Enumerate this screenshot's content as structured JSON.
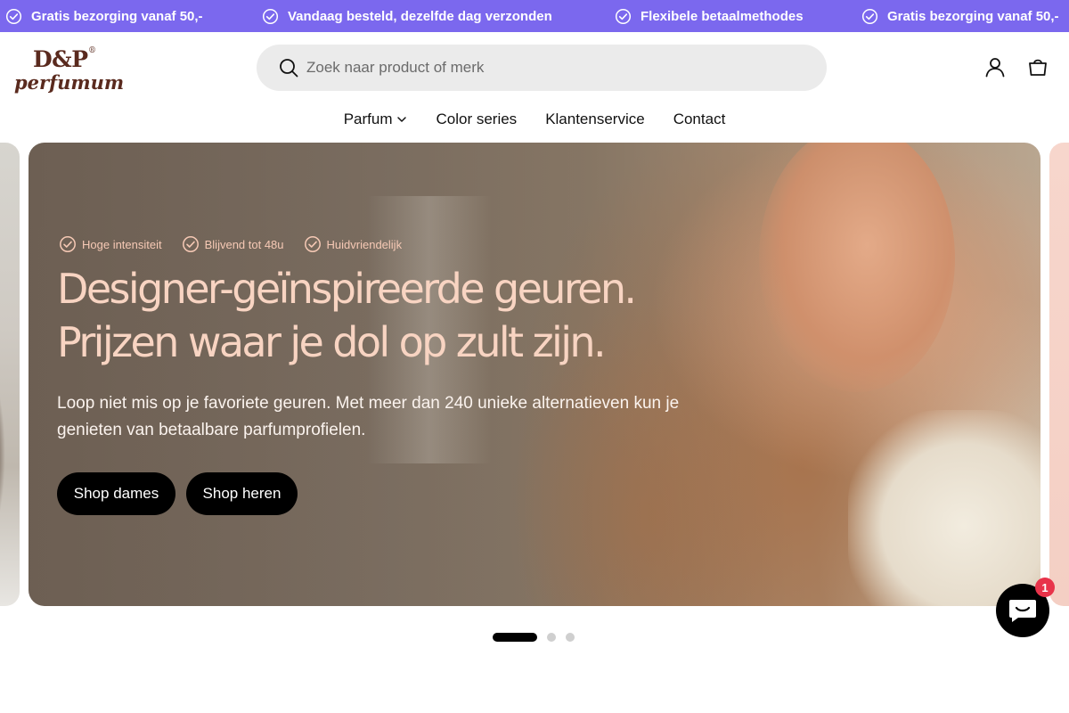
{
  "announcement": {
    "items": [
      "Gratis bezorging vanaf 50,-",
      "Vandaag besteld, dezelfde dag verzonden",
      "Flexibele betaalmethodes",
      "Gratis bezorging vanaf 50,-"
    ]
  },
  "header": {
    "logo_top": "D&P",
    "logo_reg": "®",
    "logo_bottom": "perfumum",
    "search_placeholder": "Zoek naar product of merk"
  },
  "nav": {
    "items": [
      "Parfum",
      "Color series",
      "Klantenservice",
      "Contact"
    ]
  },
  "hero": {
    "badges": [
      "Hoge intensiteit",
      "Blijvend tot 48u",
      "Huidvriendelijk"
    ],
    "title": "Designer-geïnspireerde geuren. Prijzen waar je dol op zult zijn.",
    "description": "Loop niet mis op je favoriete geuren. Met meer dan 240 unieke alternatieven kun je genieten van betaalbare parfumprofielen.",
    "buttons": [
      "Shop dames",
      "Shop heren"
    ]
  },
  "slider": {
    "active_index": 0,
    "count": 3
  },
  "chat": {
    "unread": "1"
  },
  "colors": {
    "announcement_bg": "#7b68ee",
    "logo": "#5a2a1e",
    "hero_title": "#f8d4c2",
    "badge_text": "#f6c9b5",
    "button_bg": "#000000",
    "chat_badge": "#e8334a"
  },
  "icons": {
    "announcement": "check-circle-icon",
    "search": "search-icon",
    "account": "user-icon",
    "cart": "bag-icon",
    "nav_dropdown": "chevron-down-icon",
    "chat": "chat-bubble-icon"
  }
}
